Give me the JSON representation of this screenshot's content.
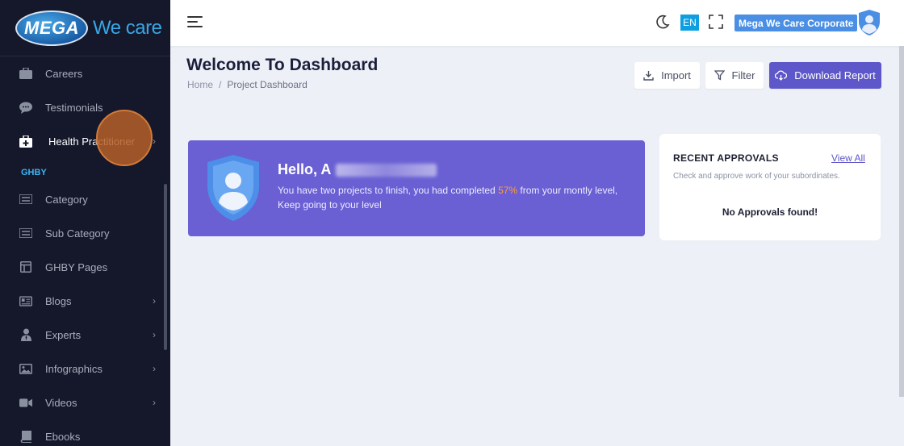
{
  "brand": {
    "logo_text": "MEGA",
    "logo_tagline": "We care"
  },
  "sidebar": {
    "items": [
      {
        "label": "Careers",
        "icon": "briefcase-icon"
      },
      {
        "label": "Testimonials",
        "icon": "chat-icon"
      },
      {
        "label": "Health Practitioner",
        "icon": "medical-kit-icon",
        "chevron": "›"
      }
    ],
    "section_label": "GHBY",
    "section_items": [
      {
        "label": "Category",
        "icon": "list-icon"
      },
      {
        "label": "Sub Category",
        "icon": "list-icon"
      },
      {
        "label": "GHBY Pages",
        "icon": "layout-icon"
      },
      {
        "label": "Blogs",
        "icon": "newspaper-icon",
        "chevron": "›"
      },
      {
        "label": "Experts",
        "icon": "user-tie-icon",
        "chevron": "›"
      },
      {
        "label": "Infographics",
        "icon": "image-icon",
        "chevron": "›"
      },
      {
        "label": "Videos",
        "icon": "video-icon",
        "chevron": "›"
      },
      {
        "label": "Ebooks",
        "icon": "book-icon"
      }
    ]
  },
  "topbar": {
    "language": "EN",
    "user_name": "Mega We Care Corporate"
  },
  "page": {
    "title": "Welcome To Dashboard",
    "breadcrumb": {
      "home": "Home",
      "separator": "/",
      "current": "Project Dashboard"
    },
    "buttons": {
      "import": "Import",
      "filter": "Filter",
      "download": "Download Report"
    }
  },
  "welcome": {
    "greeting": "Hello, A",
    "message_pre": "You have two projects to finish, you had completed ",
    "percent": "57%",
    "message_post": " from your montly level, Keep going to your level"
  },
  "approvals": {
    "title": "RECENT APPROVALS",
    "view_all": "View All",
    "subtitle": "Check and approve work of your subordinates.",
    "empty": "No Approvals found!"
  },
  "colors": {
    "sidebar_bg": "#14182a",
    "accent": "#5d57c9",
    "section": "#3db4f2",
    "highlight": "#ff9a3c"
  }
}
